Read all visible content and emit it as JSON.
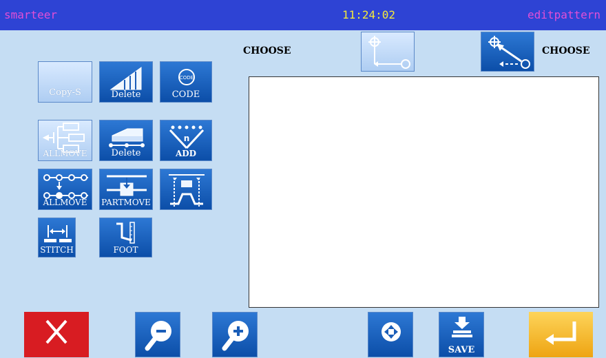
{
  "header": {
    "brand": "smarteer",
    "time": "11:24:02",
    "mode": "editpattern"
  },
  "choose": {
    "left_label": "CHOOSE",
    "right_label": "CHOOSE"
  },
  "side_buttons": {
    "copy_s": "Copy-S",
    "delete_1": "Delete",
    "code": "CODE",
    "code_badge": "CODE",
    "allmove_1": "ALLMOVE",
    "delete_2": "Delete",
    "add": "ADD",
    "add_badge": "n",
    "allmove_2": "ALLMOVE",
    "partmove": "PARTMOVE",
    "stitch": "STITCH",
    "foot": "FOOT"
  },
  "bottom": {
    "save_label": "SAVE"
  },
  "colors": {
    "topbar": "#2e43d4",
    "accent_brand": "#e24fd6",
    "clock": "#f4ea3a",
    "cancel": "#d81c22",
    "enter": "#f2b21a"
  }
}
